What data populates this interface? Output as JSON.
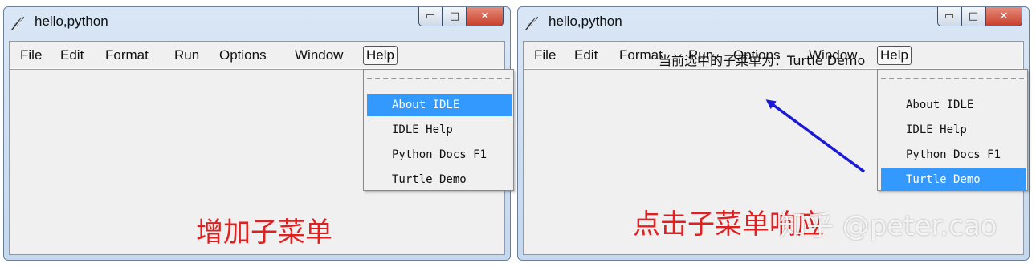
{
  "windows": [
    {
      "title": "hello,python",
      "icon": "feather-icon",
      "controls": {
        "minimize": "▭",
        "maximize": "□",
        "close": "✕"
      },
      "menus": [
        "File",
        "Edit",
        "Format",
        "Run",
        "Options",
        "Window",
        "Help"
      ],
      "open_menu": "Help",
      "dropdown_items": [
        "About IDLE",
        "IDLE Help",
        "Python Docs F1",
        "Turtle Demo"
      ],
      "highlighted_item": "About IDLE",
      "caption": "增加子菜单"
    },
    {
      "title": "hello,python",
      "icon": "feather-icon",
      "controls": {
        "minimize": "▭",
        "maximize": "□",
        "close": "✕"
      },
      "menus": [
        "File",
        "Edit",
        "Format",
        "Run",
        "Options",
        "Window",
        "Help"
      ],
      "open_menu": "Help",
      "status_label": "当前选中的子菜单为：Turtle Demo",
      "dropdown_items": [
        "About IDLE",
        "IDLE Help",
        "Python Docs F1",
        "Turtle Demo"
      ],
      "highlighted_item": "Turtle Demo",
      "caption": "点击子菜单响应"
    }
  ],
  "annotation_arrow_color": "#1a1ad6",
  "highlight_color": "#3399ff",
  "caption_color": "#e02020",
  "watermark": "知乎 @peter.cao"
}
